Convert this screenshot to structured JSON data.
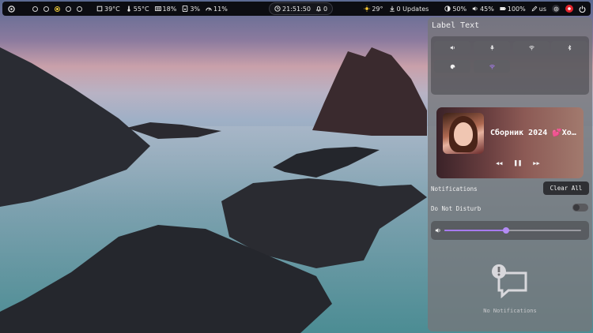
{
  "topbar": {
    "workspaces": [
      {
        "state": "idle"
      },
      {
        "state": "idle"
      },
      {
        "state": "active"
      },
      {
        "state": "idle"
      },
      {
        "state": "idle"
      }
    ],
    "cpu_temp": "39°C",
    "gpu_temp": "55°C",
    "memory": "18%",
    "disk": "3%",
    "cpu_load": "11%",
    "clock": "21:51:50",
    "notification_count": "0",
    "weather": "29°",
    "updates": "0 Updates",
    "brightness": "50%",
    "volume": "45%",
    "battery": "100%",
    "keyboard_layout": "us"
  },
  "panel": {
    "title": "Label Text",
    "quick_settings": [
      {
        "icon": "speaker-icon"
      },
      {
        "icon": "microphone-icon"
      },
      {
        "icon": "wifi-icon"
      },
      {
        "icon": "bluetooth-icon"
      },
      {
        "icon": "palette-icon"
      },
      {
        "icon": "wifi-purple-icon"
      }
    ],
    "media": {
      "title": "Сборник 2024 💕Хо…",
      "controls": {
        "prev": "◀◀",
        "pause": "❚❚",
        "next": "▶▶"
      }
    },
    "notifications_label": "Notifications",
    "clear_all": "Clear All",
    "dnd_label": "Do Not Disturb",
    "volume_level": 0.45,
    "empty_text": "No Notifications"
  },
  "colors": {
    "bar": "#0c0d12",
    "accent": "#a77af0",
    "active_workspace": "#e7c53b",
    "record_dot": "#e0242c"
  }
}
